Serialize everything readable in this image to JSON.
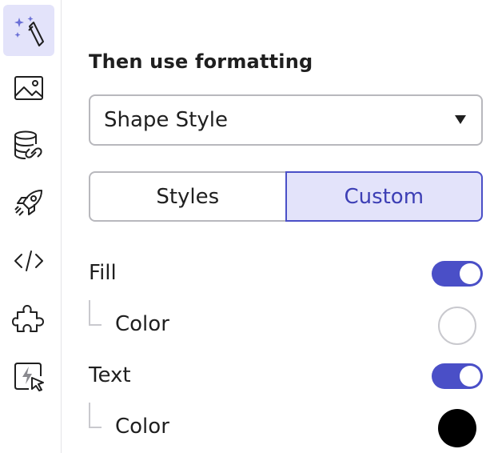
{
  "sidebar": {
    "items": [
      {
        "icon": "magic-wand-icon",
        "active": true
      },
      {
        "icon": "image-icon",
        "active": false
      },
      {
        "icon": "database-link-icon",
        "active": false
      },
      {
        "icon": "rocket-icon",
        "active": false
      },
      {
        "icon": "code-icon",
        "active": false
      },
      {
        "icon": "puzzle-icon",
        "active": false
      },
      {
        "icon": "lightning-cursor-icon",
        "active": false
      }
    ]
  },
  "panel": {
    "title": "Then use formatting",
    "select": {
      "value": "Shape Style"
    },
    "segments": {
      "left": "Styles",
      "right": "Custom",
      "selected": "Custom"
    },
    "fill": {
      "label": "Fill",
      "enabled": true,
      "color_label": "Color",
      "color": "#ffffff"
    },
    "text": {
      "label": "Text",
      "enabled": true,
      "color_label": "Color",
      "color": "#000000"
    }
  },
  "colors": {
    "accent": "#4a4fc7",
    "accent_light": "#e3e3fa"
  }
}
